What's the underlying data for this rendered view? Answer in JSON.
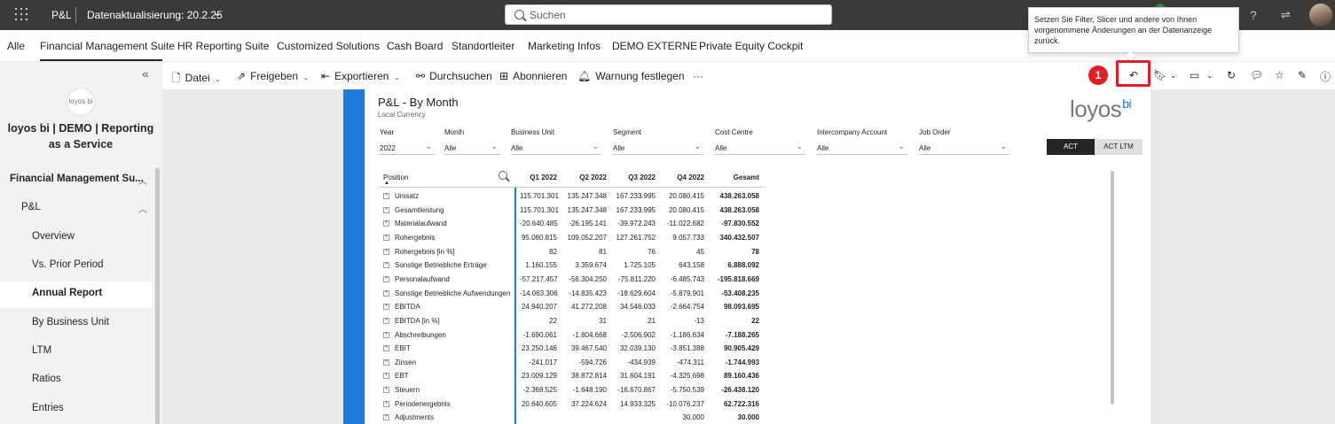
{
  "topbar": {
    "app_name": "P&L",
    "refresh_label": "Datenaktualisierung: 20.2.25",
    "search_placeholder": "Suchen",
    "help_icon": "question-icon",
    "share_icon": "share-icon"
  },
  "tabs": [
    "Alle",
    "Financial Management Suite",
    "HR Reporting Suite",
    "Customized Solutions",
    "Cash Board",
    "Standortleiter",
    "Marketing Infos",
    "DEMO EXTERNE",
    "Private Equity Cockpit"
  ],
  "active_tab": "Financial Management Suite",
  "leftnav": {
    "logo_text": "loyos bi",
    "workspace_title": "loyos bi | DEMO | Reporting as a Service",
    "section": "Financial Management Su...",
    "subsection": "P&L",
    "items": [
      "Overview",
      "Vs. Prior Period",
      "Annual Report",
      "By Business Unit",
      "LTM",
      "Ratios",
      "Entries"
    ],
    "selected": "Annual Report"
  },
  "actionbar": {
    "file": "Datei",
    "share": "Freigeben",
    "export": "Exportieren",
    "explore": "Durchsuchen",
    "subscribe": "Abonnieren",
    "alert": "Warnung festlegen",
    "more": "···"
  },
  "tooltip": "Setzen Sie Filter, Slicer und andere von Ihnen vorgenommene Änderungen an der Datenanzeige zurück.",
  "badge": "1",
  "report": {
    "title": "P&L - By Month",
    "subtitle": "Local Currency",
    "logo_text": "loyos",
    "logo_sup": "bi",
    "slicers": [
      {
        "label": "Year",
        "value": "2022"
      },
      {
        "label": "Month",
        "value": "Alle"
      },
      {
        "label": "Business Unit",
        "value": "Alle"
      },
      {
        "label": "Segment",
        "value": "Alle"
      },
      {
        "label": "Cost Centre",
        "value": "Alle"
      },
      {
        "label": "Intercompany Account",
        "value": "Alle"
      },
      {
        "label": "Job Order",
        "value": "Alle"
      }
    ],
    "toggle": {
      "act": "ACT",
      "act_ltm": "ACT LTM"
    }
  },
  "matrix": {
    "position_header": "Position",
    "columns": [
      "Q1 2022",
      "Q2 2022",
      "Q3 2022",
      "Q4 2022",
      "Gesamt"
    ],
    "rows": [
      {
        "label": "Umsatz",
        "values": [
          "115.701.301",
          "135.247.348",
          "167.233.995",
          "20.080.415",
          "438.263.058"
        ]
      },
      {
        "label": "Gesamtleistung",
        "values": [
          "115.701.301",
          "135.247.348",
          "167.233.995",
          "20.080.415",
          "438.263.058"
        ]
      },
      {
        "label": "Materialaufwand",
        "values": [
          "-20.640.485",
          "-26.195.141",
          "-39.972.243",
          "-11.022.682",
          "-97.830.552"
        ]
      },
      {
        "label": "Rohergebnis",
        "values": [
          "95.060.815",
          "109.052.207",
          "127.261.752",
          "9.057.733",
          "340.432.507"
        ]
      },
      {
        "label": "Rohergebnis [in %]",
        "values": [
          "82",
          "81",
          "76",
          "45",
          "78"
        ]
      },
      {
        "label": "Sonstige Betriebliche Erträge",
        "values": [
          "1.160.155",
          "3.359.674",
          "1.725.105",
          "643.158",
          "6.888.092"
        ]
      },
      {
        "label": "Personalaufwand",
        "values": [
          "-57.217.457",
          "-56.304.250",
          "-75.811.220",
          "-6.485.743",
          "-195.818.669"
        ]
      },
      {
        "label": "Sonstige Betriebliche Aufwendungen",
        "values": [
          "-14.063.306",
          "-14.835.423",
          "-18.629.604",
          "-5.879.901",
          "-53.408.235"
        ]
      },
      {
        "label": "EBITDA",
        "values": [
          "24.940.207",
          "41.272.208",
          "34.546.033",
          "-2.664.754",
          "98.093.695"
        ]
      },
      {
        "label": "EBITDA [in %]",
        "values": [
          "22",
          "31",
          "21",
          "-13",
          "22"
        ]
      },
      {
        "label": "Abschreibungen",
        "values": [
          "-1.690.061",
          "-1.804.668",
          "-2.506.902",
          "-1.186.634",
          "-7.188.265"
        ]
      },
      {
        "label": "EBIT",
        "values": [
          "23.250.146",
          "39.467.540",
          "32.039.130",
          "-3.851.388",
          "90.905.429"
        ]
      },
      {
        "label": "Zinsen",
        "values": [
          "-241.017",
          "-594.726",
          "-434.939",
          "-474.311",
          "-1.744.993"
        ]
      },
      {
        "label": "EBT",
        "values": [
          "23.009.129",
          "38.872.814",
          "31.604.191",
          "-4.325.698",
          "89.160.436"
        ]
      },
      {
        "label": "Steuern",
        "values": [
          "-2.368.525",
          "-1.648.190",
          "-16.670.867",
          "-5.750.539",
          "-26.438.120"
        ]
      },
      {
        "label": "Periodenergebnis",
        "values": [
          "20.640.605",
          "37.224.624",
          "14.933.325",
          "-10.076.237",
          "62.722.316"
        ]
      },
      {
        "label": "Adjustments",
        "values": [
          "",
          "",
          "",
          "30.000",
          "30.000"
        ]
      }
    ]
  },
  "colors": {
    "accent": "#1f7ae0",
    "highlight": "#e51c23",
    "topbar": "#3b3a39"
  }
}
